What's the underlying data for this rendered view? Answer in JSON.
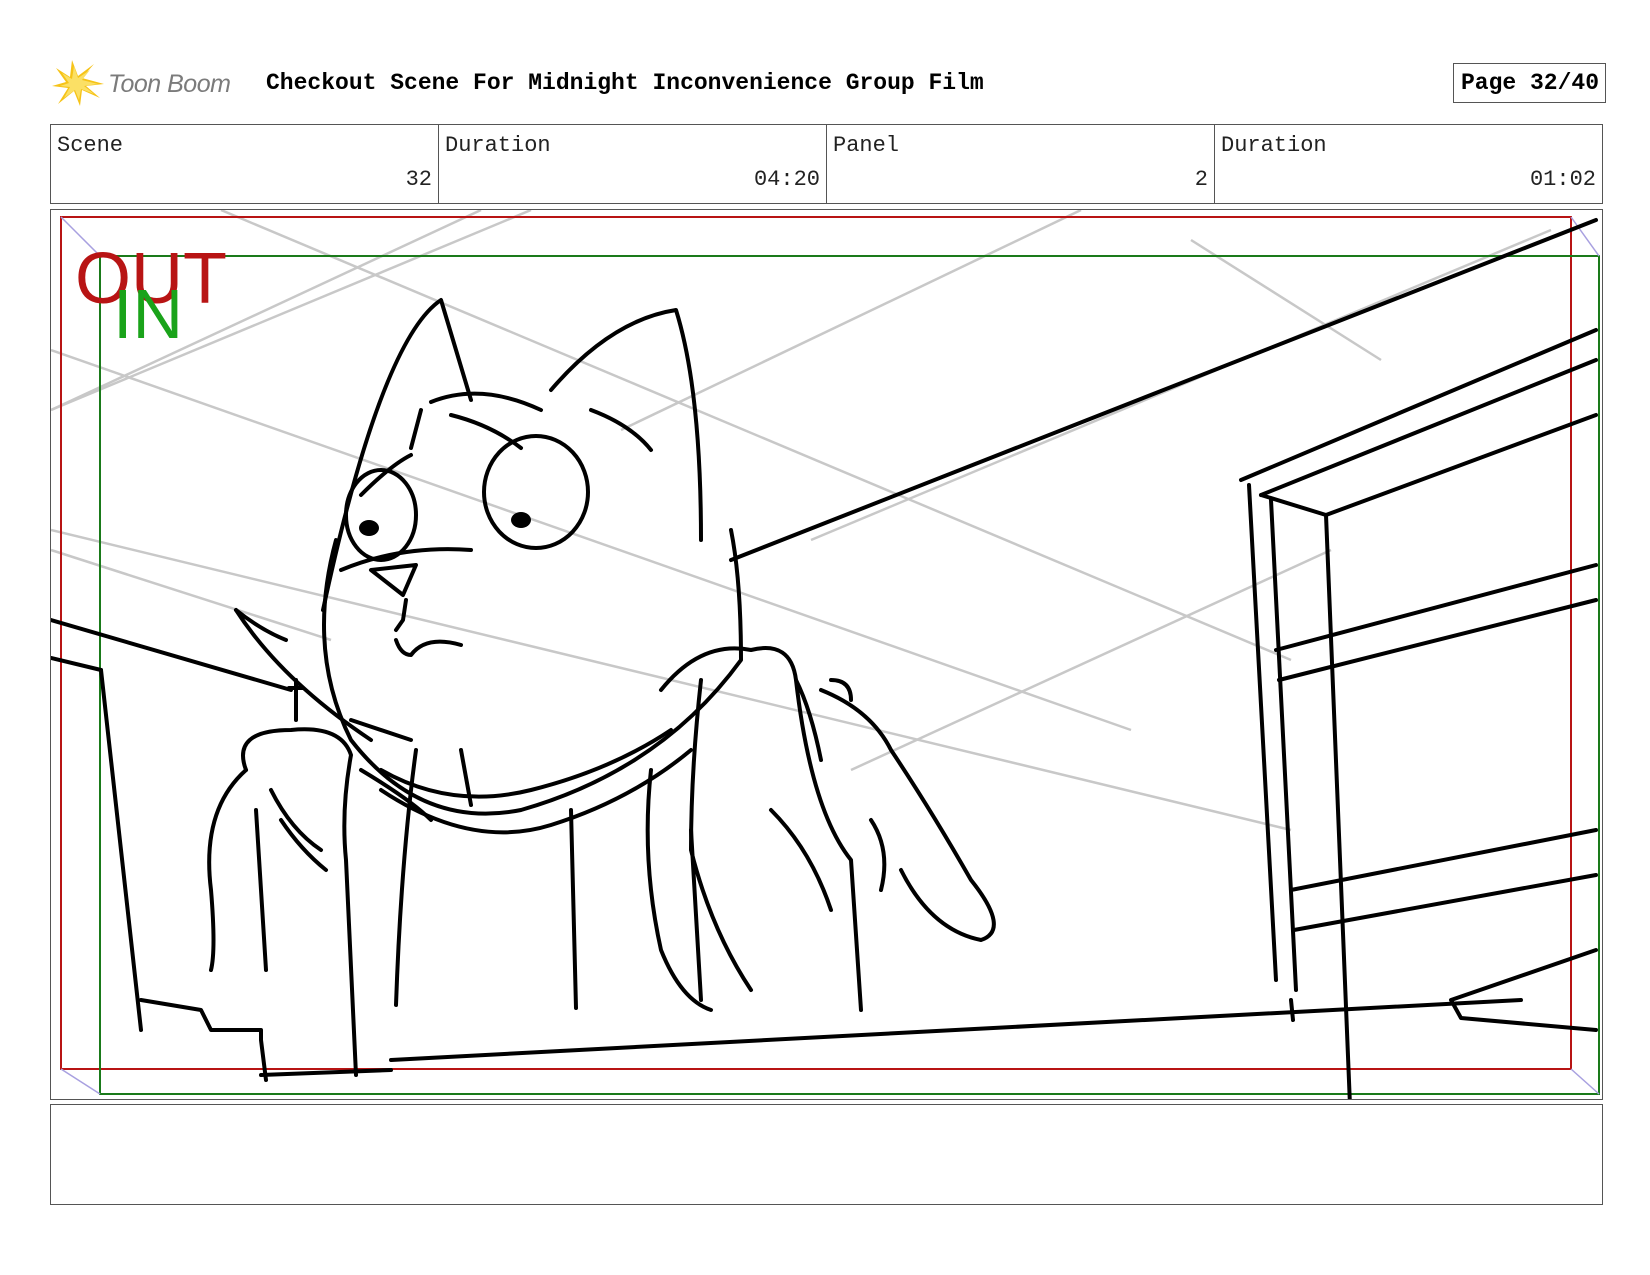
{
  "header": {
    "brand": "Toon Boom",
    "title": "Checkout Scene For Midnight Inconvenience Group Film",
    "page": "Page 32/40"
  },
  "info": {
    "scene_label": "Scene",
    "scene_value": "32",
    "scene_duration_label": "Duration",
    "scene_duration_value": "04:20",
    "panel_label": "Panel",
    "panel_value": "2",
    "panel_duration_label": "Duration",
    "panel_duration_value": "01:02"
  },
  "panel": {
    "out_label": "OUT",
    "in_label": "IN",
    "out_color": "#b81414",
    "in_color": "#1aa31a"
  },
  "notes": {
    "text": ""
  }
}
